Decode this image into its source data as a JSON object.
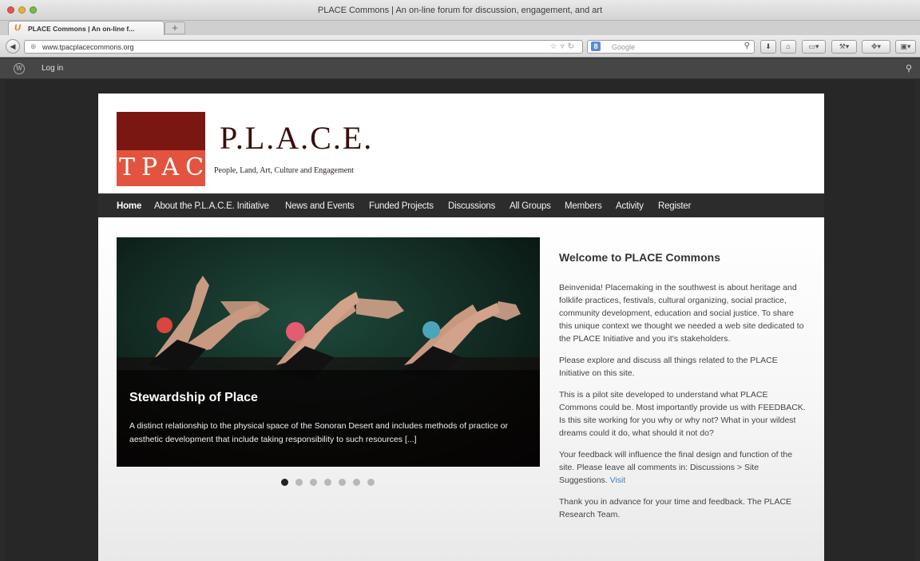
{
  "window": {
    "title": "PLACE Commons | An on-line forum for discussion, engagement, and art",
    "tab_label": "PLACE Commons | An on-line f...",
    "new_tab": "+"
  },
  "toolbar": {
    "url": "www.tpacplacecommons.org",
    "search_placeholder": "Google",
    "search_engine_icon": "google-icon"
  },
  "wp_admin_bar": {
    "login_label": "Log in"
  },
  "site": {
    "logo_text": "TPAC",
    "title": "P.L.A.C.E.",
    "tagline": "People, Land, Art, Culture and Engagement"
  },
  "nav": {
    "items": [
      {
        "label": "Home",
        "active": true
      },
      {
        "label": "About the P.L.A.C.E. Initiative"
      },
      {
        "label": "News and Events"
      },
      {
        "label": "Funded Projects"
      },
      {
        "label": "Discussions"
      },
      {
        "label": "All Groups"
      },
      {
        "label": "Members"
      },
      {
        "label": "Activity"
      },
      {
        "label": "Register"
      }
    ]
  },
  "slider": {
    "title": "Stewardship of Place",
    "text": "A distinct relationship to the physical space of the Sonoran Desert and includes methods of practice or aesthetic development that include taking responsibility to such resources [...]",
    "slide_count": 7,
    "active_index": 0
  },
  "welcome": {
    "title": "Welcome to PLACE Commons",
    "p1": "Beinvenida! Placemaking in the southwest is about heritage and folklife practices, festivals, cultural organizing, social practice, community development, education and social justice. To share this unique context we thought we needed a web site dedicated to the PLACE Initiative and you it's stakeholders.",
    "p2": "Please explore and discuss all things related to the PLACE Initiative on this site.",
    "p3": "This is a pilot site developed to understand what PLACE Commons could be. Most importantly provide us with FEEDBACK. Is this site working for you why or why not? What in your wildest dreams could it do, what should it not do?",
    "p4": "Your feedback will influence the final design and function of the site. Please leave all comments in: Discussions > Site Suggestions.",
    "p4_link": "Visit",
    "p5": "Thank you in advance for your time and feedback. The PLACE Research Team."
  },
  "colors": {
    "logo_dark": "#7a1712",
    "logo_light": "#e2543f",
    "nav_bg": "#2c2c2c",
    "link": "#3b7fc4"
  }
}
